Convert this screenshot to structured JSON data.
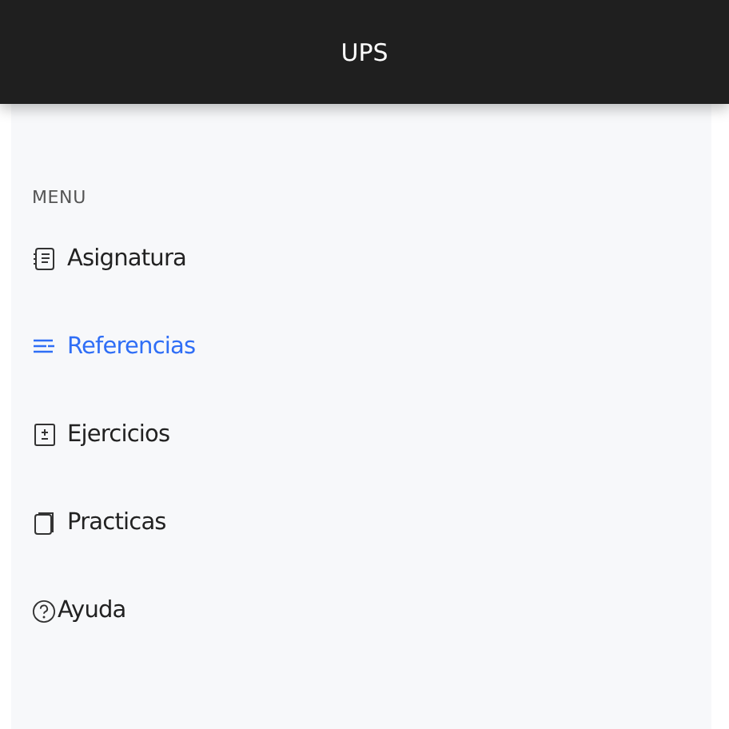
{
  "header": {
    "title": "UPS"
  },
  "menu": {
    "heading": "MENU",
    "items": [
      {
        "label": "Asignatura",
        "kind": "document",
        "selected": false
      },
      {
        "label": "Referencias",
        "kind": "lines",
        "selected": true
      },
      {
        "label": "Ejercicios",
        "kind": "plusminus",
        "selected": false
      },
      {
        "label": "Practicas",
        "kind": "pages",
        "selected": false
      },
      {
        "label": "Ayuda",
        "kind": "help",
        "selected": false
      }
    ]
  }
}
